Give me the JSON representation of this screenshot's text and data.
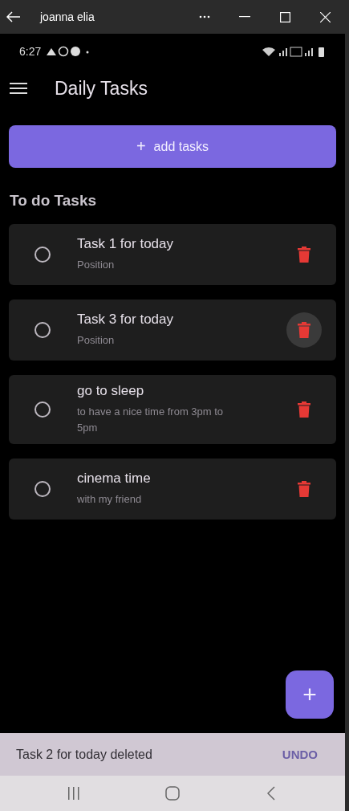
{
  "window": {
    "title": "joanna elia"
  },
  "status_bar": {
    "time": "6:27"
  },
  "app_bar": {
    "title": "Daily Tasks"
  },
  "add_button": {
    "icon": "+",
    "label": "add tasks"
  },
  "section_title": "To do Tasks",
  "tasks": [
    {
      "title": "Task 1 for today",
      "subtitle": "Position",
      "done": false,
      "delete_hovered": false
    },
    {
      "title": "Task 3 for today",
      "subtitle": "Position",
      "done": false,
      "delete_hovered": true
    },
    {
      "title": "go to sleep",
      "subtitle": "to have a nice time from 3pm to 5pm",
      "done": false,
      "delete_hovered": false
    },
    {
      "title": "cinema time",
      "subtitle": "with my friend",
      "done": false,
      "delete_hovered": false
    }
  ],
  "fab": {
    "icon": "+"
  },
  "snackbar": {
    "message": "Task 2 for today deleted",
    "action": "UNDO"
  }
}
